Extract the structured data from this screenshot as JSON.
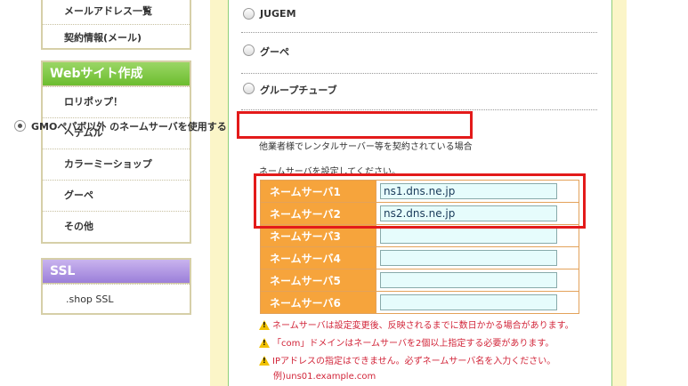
{
  "sidebar": {
    "mail_box": {
      "items": [
        "メールアドレス一覧",
        "契約情報(メール)"
      ]
    },
    "web_box": {
      "title": "Webサイト作成",
      "items": [
        "ロリポップ！",
        "ヘテムル",
        "カラーミーショップ",
        "グーペ",
        "その他"
      ]
    },
    "ssl_box": {
      "title": "SSL",
      "items": [
        ".shop SSL"
      ]
    }
  },
  "options": {
    "jugem": "JUGEM",
    "goope": "グーペ",
    "group": "グループチューブ",
    "gmo": "GMOペパボ以外 のネームサーバを使用する",
    "gmo_desc": "他業者様でレンタルサーバー等を契約されている場合",
    "selected": "gmo"
  },
  "nameservers": {
    "instruction": "ネームサーバを設定してください。",
    "rows": [
      {
        "label": "ネームサーバ1",
        "value": "ns1.dns.ne.jp"
      },
      {
        "label": "ネームサーバ2",
        "value": "ns2.dns.ne.jp"
      },
      {
        "label": "ネームサーバ3",
        "value": ""
      },
      {
        "label": "ネームサーバ4",
        "value": ""
      },
      {
        "label": "ネームサーバ5",
        "value": ""
      },
      {
        "label": "ネームサーバ6",
        "value": ""
      }
    ]
  },
  "notes": [
    "ネームサーバは設定変更後、反映されるまでに数日かかる場合があります。",
    "「com」ドメインはネームサーバを2個以上指定する必要があります。",
    "IPアドレスの指定はできません。必ずネームサーバ名を入力ください。"
  ],
  "note_example": "例)uns01.example.com",
  "colors": {
    "highlight": "#e31a1a",
    "table_header": "#f6a43c",
    "note_text": "#d2263a",
    "web_head": "#6cbd2f",
    "ssl_head": "#9b7fd9"
  }
}
